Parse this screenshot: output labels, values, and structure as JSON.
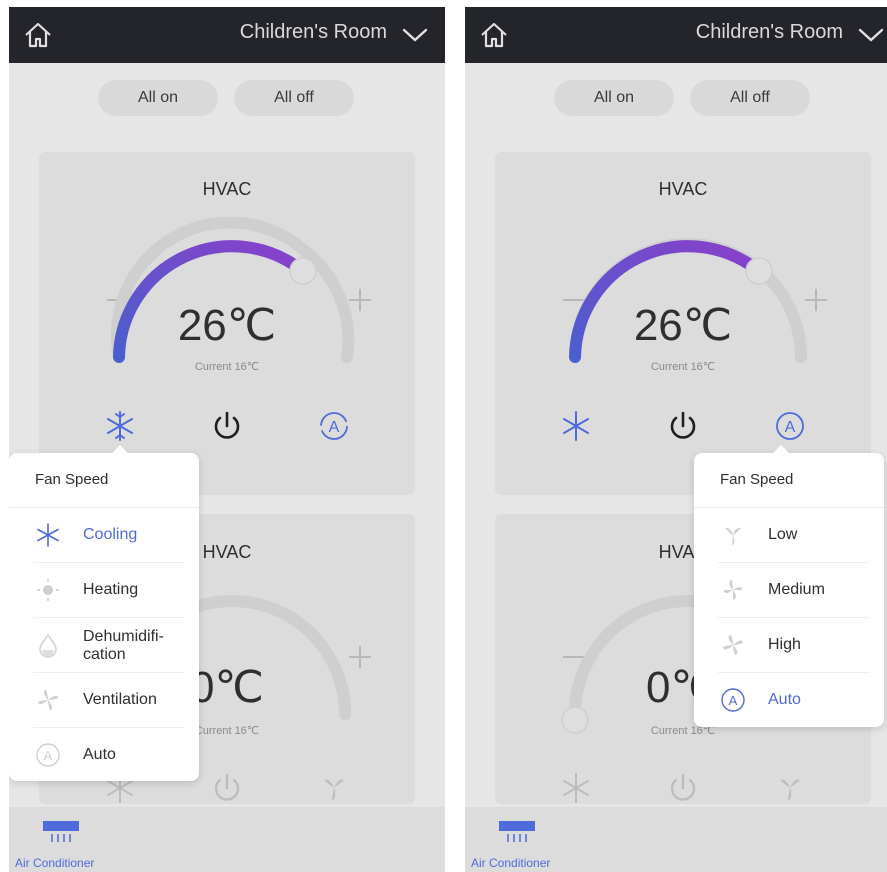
{
  "colors": {
    "topbar": "#24242b",
    "accent": "#4f6bdb",
    "gauge_start": "#4a5fce",
    "gauge_end": "#8b3fc9",
    "gauge_track": "#cfcfcf",
    "overlay": "#e6e6e6"
  },
  "screens": [
    {
      "header": {
        "room": "Children's Room",
        "home_icon": "home-icon",
        "dropdown_icon": "chevron-down-icon"
      },
      "actions": {
        "all_on": "All on",
        "all_off": "All off"
      },
      "devices": [
        {
          "title": "HVAC",
          "temperature": "26℃",
          "current": "Current 16℃",
          "setpoint_fraction": 0.62
        },
        {
          "title": "HVAC",
          "temperature": "0℃",
          "current": "Current 16℃",
          "setpoint_fraction": 0.0
        }
      ],
      "popup": {
        "title": "Fan Speed",
        "items": [
          {
            "label": "Cooling",
            "icon": "snowflake-icon",
            "active": true
          },
          {
            "label": "Heating",
            "icon": "sun-icon",
            "active": false
          },
          {
            "label": "Dehumidifi-\ncation",
            "icon": "droplet-icon",
            "active": false
          },
          {
            "label": "Ventilation",
            "icon": "fan-icon",
            "active": false
          },
          {
            "label": "Auto",
            "icon": "auto-icon",
            "active": false
          }
        ]
      },
      "nav": {
        "label": "Air Conditioner",
        "icon": "air-conditioner-icon"
      }
    },
    {
      "header": {
        "room": "Children's Room",
        "home_icon": "home-icon",
        "dropdown_icon": "chevron-down-icon"
      },
      "actions": {
        "all_on": "All on",
        "all_off": "All off"
      },
      "devices": [
        {
          "title": "HVAC",
          "temperature": "26℃",
          "current": "Current 16℃",
          "setpoint_fraction": 0.62
        },
        {
          "title": "HVAC",
          "temperature": "0℃",
          "current": "Current 16℃",
          "setpoint_fraction": 0.0
        }
      ],
      "popup": {
        "title": "Fan Speed",
        "items": [
          {
            "label": "Low",
            "icon": "fan-low-icon",
            "active": false
          },
          {
            "label": "Medium",
            "icon": "fan-medium-icon",
            "active": false
          },
          {
            "label": "High",
            "icon": "fan-high-icon",
            "active": false
          },
          {
            "label": "Auto",
            "icon": "auto-icon",
            "active": true
          }
        ]
      },
      "nav": {
        "label": "Air Conditioner",
        "icon": "air-conditioner-icon"
      }
    }
  ]
}
